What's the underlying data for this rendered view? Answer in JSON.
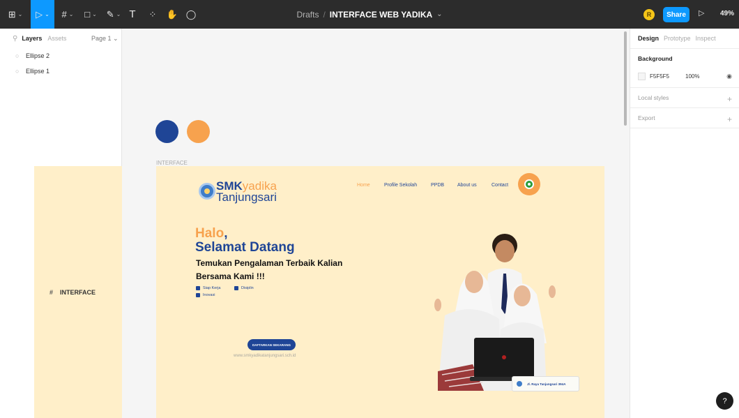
{
  "toolbar": {
    "tools": [
      {
        "name": "main-menu-icon",
        "glyph": "⊞"
      },
      {
        "name": "move-tool-icon",
        "glyph": "▷"
      },
      {
        "name": "frame-tool-icon",
        "glyph": "#"
      },
      {
        "name": "shape-tool-icon",
        "glyph": "□"
      },
      {
        "name": "pen-tool-icon",
        "glyph": "✎"
      },
      {
        "name": "text-tool-icon",
        "glyph": "T"
      },
      {
        "name": "resources-icon",
        "glyph": "⁘"
      },
      {
        "name": "hand-tool-icon",
        "glyph": "✋"
      },
      {
        "name": "comment-tool-icon",
        "glyph": "◯"
      }
    ],
    "breadcrumb_drafts": "Drafts",
    "breadcrumb_sep": "/",
    "file_name": "INTERFACE WEB YADIKA",
    "file_caret": "⌄",
    "avatar_initial": "R",
    "share_label": "Share",
    "play_icon": "▷",
    "zoom": "49%"
  },
  "layers_panel": {
    "tab_layers": "Layers",
    "tab_assets": "Assets",
    "page": "Page 1",
    "items": [
      {
        "name": "Ellipse 2",
        "icon": "ellipse-icon"
      },
      {
        "name": "Ellipse 1",
        "icon": "ellipse-icon"
      },
      {
        "name": "INTERFACE",
        "icon": "frame-icon"
      }
    ]
  },
  "canvas": {
    "frame_label": "INTERFACE",
    "colors": {
      "blue": "#1f4596",
      "orange": "#f7a24e",
      "frame_bg": "#ffefc9",
      "canvas_bg": "#f5f5f5"
    },
    "site": {
      "logo_smk": "SMK",
      "logo_yadika": "yadika",
      "logo_line2": "Tanjungsari",
      "nav": [
        "Home",
        "Profile Sekolah",
        "PPDB",
        "About us",
        "Contact"
      ],
      "hero_halo": "Halo",
      "hero_comma": ",",
      "hero_title": "Selamat Datang",
      "hero_tagline": "Temukan Pengalaman Terbaik Kalian Bersama Kami !!!",
      "features": [
        "Siap Kerja",
        "Disiplin",
        "Inovasi"
      ],
      "cta_label": "DAFTARKAN SEKARANG",
      "url": "www.smkyadikatanjungsari.sch.id",
      "address": "Jl. Raya Tanjungsari 394A"
    }
  },
  "design_panel": {
    "tabs": [
      "Design",
      "Prototype",
      "Inspect"
    ],
    "background_title": "Background",
    "background_hex": "F5F5F5",
    "background_opacity": "100%",
    "local_styles": "Local styles",
    "export": "Export",
    "plus": "+"
  },
  "help_label": "?"
}
